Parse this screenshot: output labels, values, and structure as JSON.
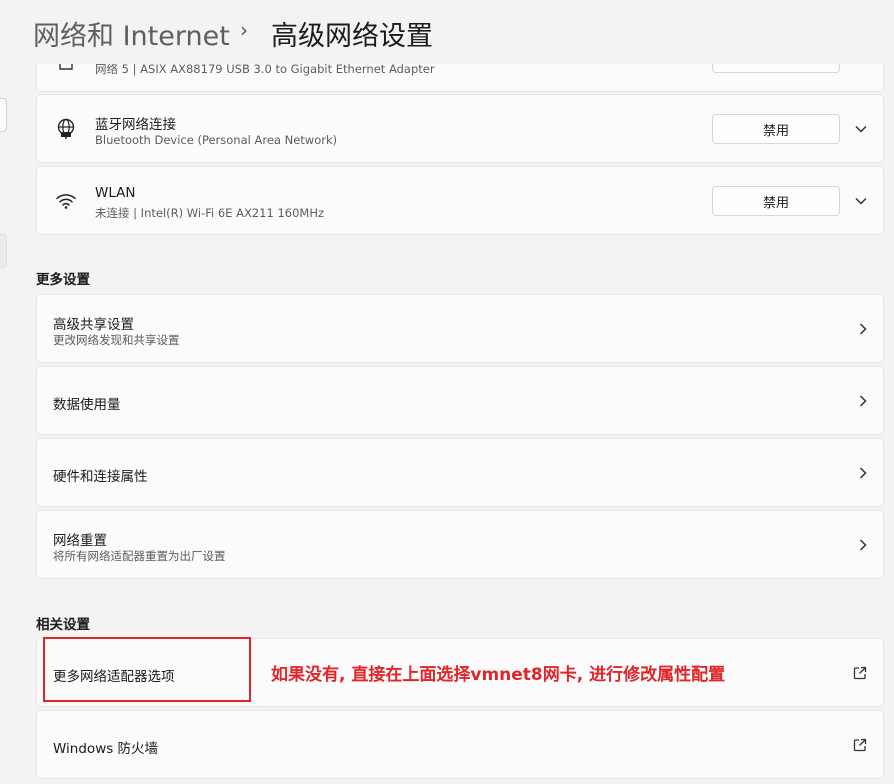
{
  "breadcrumb": {
    "parent": "网络和 Internet",
    "separator": "›",
    "current": "高级网络设置"
  },
  "adapters": [
    {
      "name": "",
      "description": "网络 5 | ASIX AX88179 USB 3.0 to Gigabit Ethernet Adapter",
      "icon": "ethernet-icon"
    },
    {
      "name": "蓝牙网络连接",
      "description": "Bluetooth Device (Personal Area Network)",
      "button": "禁用",
      "icon": "globe-network-icon"
    },
    {
      "name": "WLAN",
      "description": "未连接 | Intel(R) Wi-Fi 6E AX211 160MHz",
      "button": "禁用",
      "icon": "wifi-icon"
    }
  ],
  "more_settings": {
    "heading": "更多设置",
    "items": [
      {
        "title": "高级共享设置",
        "subtitle": "更改网络发现和共享设置"
      },
      {
        "title": "数据使用量"
      },
      {
        "title": "硬件和连接属性"
      },
      {
        "title": "网络重置",
        "subtitle": "将所有网络适配器重置为出厂设置"
      }
    ]
  },
  "related_settings": {
    "heading": "相关设置",
    "items": [
      {
        "title": "更多网络适配器选项"
      },
      {
        "title": "Windows 防火墙"
      }
    ]
  },
  "annotation": {
    "text": "如果没有, 直接在上面选择vmnet8网卡, 进行修改属性配置",
    "color": "#e0262a"
  }
}
